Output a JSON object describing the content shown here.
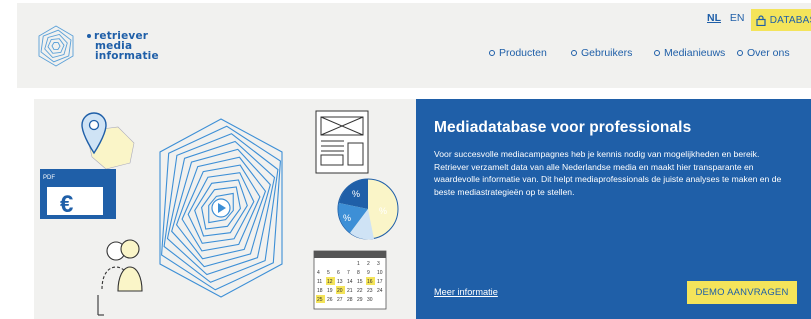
{
  "logo": {
    "line1": "retriever",
    "line2": "media",
    "line3": "informatie"
  },
  "header": {
    "languages": [
      {
        "label": "NL",
        "active": true
      },
      {
        "label": "EN",
        "active": false
      }
    ],
    "database_button": "DATABASE",
    "nav": [
      {
        "label": "Producten"
      },
      {
        "label": "Gebruikers"
      },
      {
        "label": "Medianieuws"
      },
      {
        "label": "Over ons"
      }
    ]
  },
  "hero": {
    "title": "Mediadatabase voor professionals",
    "body": "Voor succesvolle mediacampagnes heb je kennis nodig van mogelijkheden en bereik. Retriever verzamelt data van alle Nederlandse media en maakt hier transparante en waardevolle informatie van. Dit helpt mediaprofessionals de juiste analyses te maken en de beste mediastrategieën op te stellen.",
    "more_link": "Meer informatie",
    "demo_button": "DEMO AANVRAGEN"
  },
  "illustration": {
    "pdf_label": "PDF",
    "euro_symbol": "€",
    "percent_symbol": "%",
    "calendar_numbers": [
      "1",
      "2",
      "3",
      "4",
      "5",
      "6",
      "7",
      "8",
      "9",
      "10",
      "11",
      "12",
      "13",
      "14",
      "15",
      "16",
      "17",
      "18",
      "19",
      "20",
      "21",
      "22",
      "23",
      "24",
      "25",
      "26",
      "27",
      "28",
      "29",
      "30"
    ]
  },
  "colors": {
    "brand_blue": "#1f5fa8",
    "accent_yellow": "#f4e45a",
    "header_bg": "#f1f1ef",
    "light_blue": "#5aa0d8"
  }
}
